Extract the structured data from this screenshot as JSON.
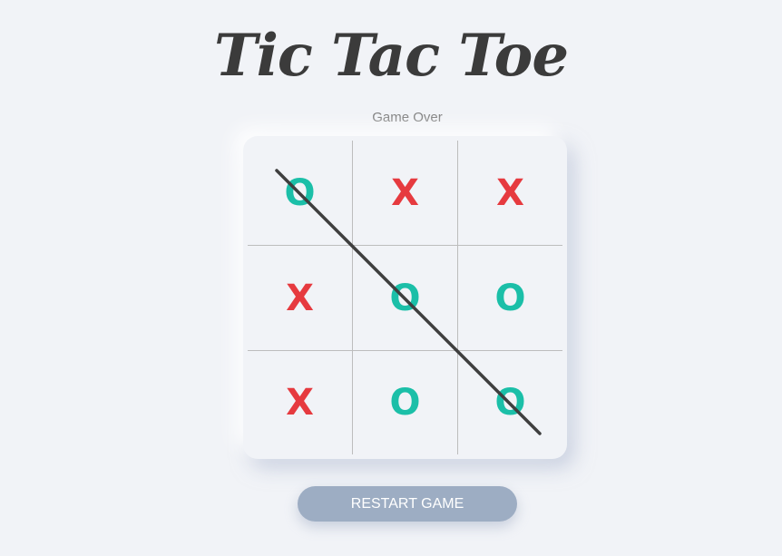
{
  "title": "Tic Tac Toe",
  "status": "Game Over",
  "board": {
    "cells": [
      "O",
      "X",
      "X",
      "X",
      "O",
      "O",
      "X",
      "O",
      "O"
    ],
    "winning_line": [
      0,
      4,
      8
    ]
  },
  "colors": {
    "x_mark": "#e63a3f",
    "o_mark": "#1bbfa8",
    "win_line": "#3f3f3f",
    "restart_button": "#9dadc3",
    "background": "#f1f3f7"
  },
  "restart_label": "RESTART GAME"
}
